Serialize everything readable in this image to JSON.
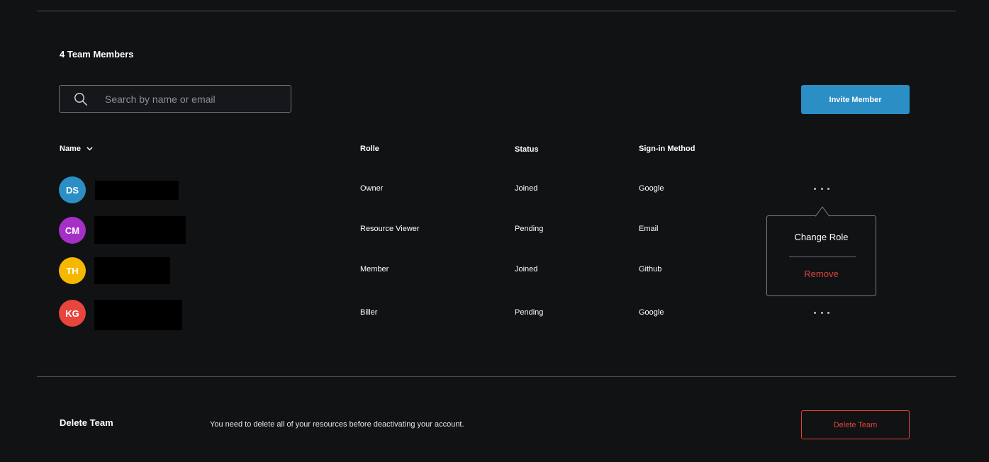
{
  "members_count_label": "4 Team Members",
  "search": {
    "placeholder": "Search by name or email",
    "icon": "search-icon"
  },
  "invite_button": {
    "label": "Invite Member",
    "color": "#2b8fc6"
  },
  "columns": {
    "name": "Name",
    "role": "Rolle",
    "status": "Status",
    "signin": "Sign-in Method"
  },
  "members": [
    {
      "initials": "DS",
      "avatar_color": "#2b8fc6",
      "role": "Owner",
      "status": "Joined",
      "signin": "Google"
    },
    {
      "initials": "CM",
      "avatar_color": "#a52fc7",
      "role": "Resource Viewer",
      "status": "Pending",
      "signin": "Email"
    },
    {
      "initials": "TH",
      "avatar_color": "#f5b800",
      "role": "Member",
      "status": "Joined",
      "signin": "Github"
    },
    {
      "initials": "KG",
      "avatar_color": "#e8453c",
      "role": "Biller",
      "status": "Pending",
      "signin": "Google"
    }
  ],
  "row_menu": {
    "change_role": "Change Role",
    "remove": "Remove"
  },
  "delete_section": {
    "title": "Delete Team",
    "description": "You need to delete all of your resources before deactivating your account.",
    "button_label": "Delete Team",
    "danger_color": "#e0453a"
  }
}
